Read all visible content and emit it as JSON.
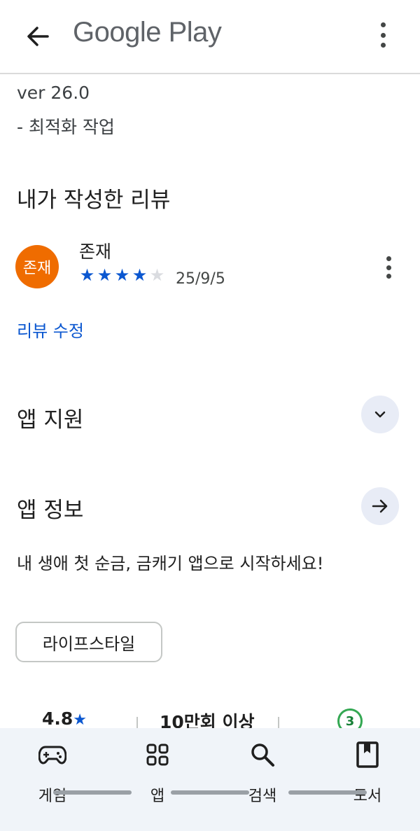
{
  "header": {
    "title": "Google Play"
  },
  "whats_new": {
    "version": "ver 26.0",
    "note": "- 최적화 작업"
  },
  "my_review": {
    "section_title": "내가 작성한 리뷰",
    "avatar_text": "존재",
    "avatar_color": "#ef6c00",
    "reviewer_name": "존재",
    "rating": 4,
    "rating_max": 5,
    "date": "25/9/5",
    "edit_label": "리뷰 수정"
  },
  "app_support": {
    "title": "앱 지원"
  },
  "app_info": {
    "title": "앱 정보",
    "description": "내 생애 첫 순금, 금캐기 앱으로 시작하세요!",
    "category_chip": "라이프스타일"
  },
  "stats": {
    "rating": "4.8",
    "downloads": "10만회 이상",
    "age_rating": "3"
  },
  "bottom_nav": {
    "items": [
      "게임",
      "앱",
      "검색",
      "도서"
    ]
  },
  "colors": {
    "accent": "#0b57d0",
    "nav_background": "#f0f4f9",
    "age_badge": "#34a853"
  }
}
